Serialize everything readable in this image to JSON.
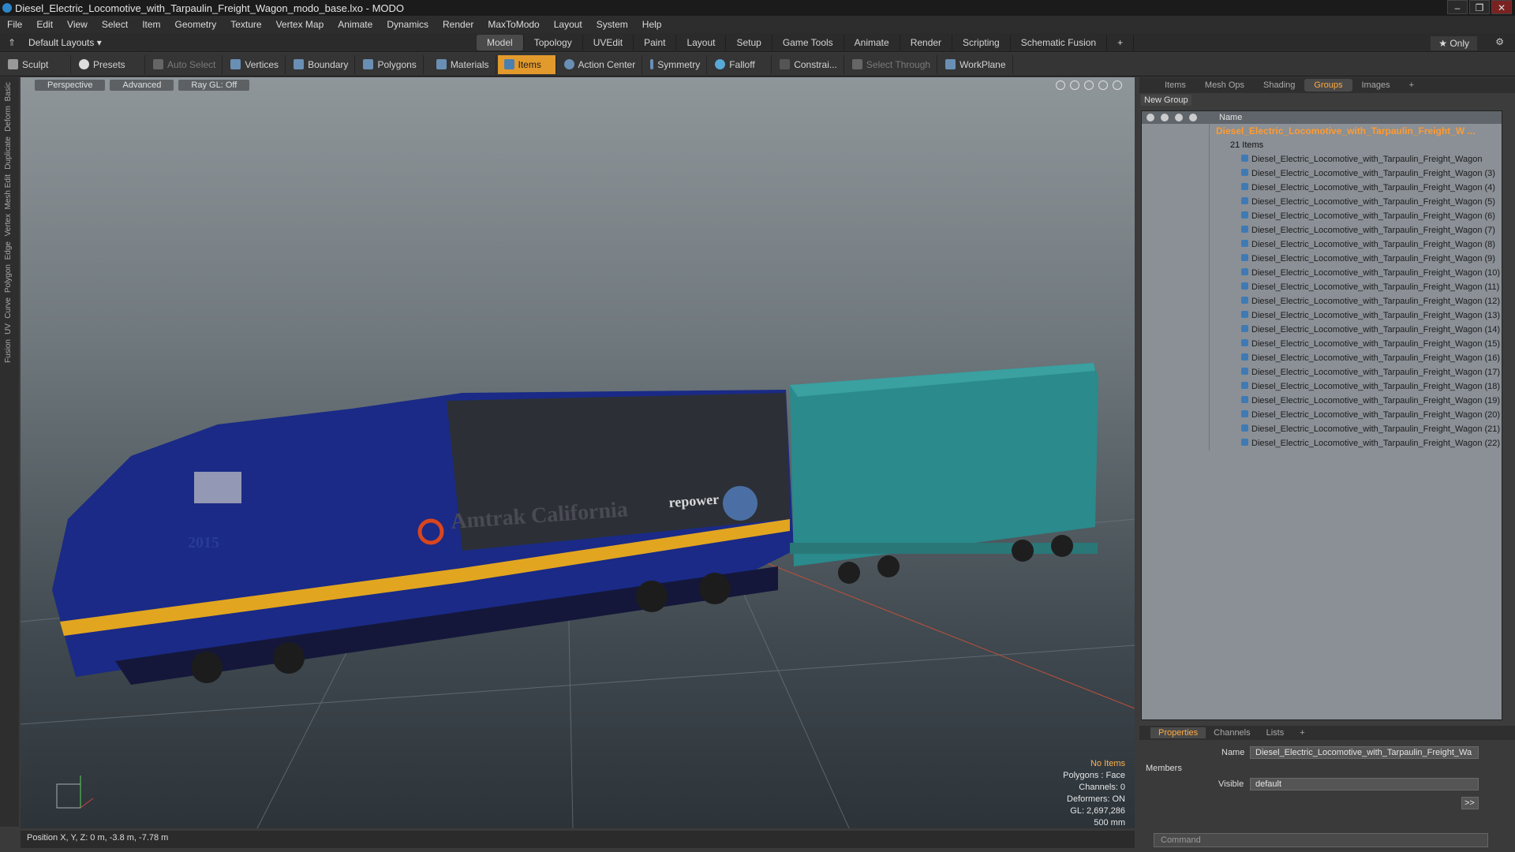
{
  "window": {
    "title": "Diesel_Electric_Locomotive_with_Tarpaulin_Freight_Wagon_modo_base.lxo - MODO",
    "controls": [
      "–",
      "❐",
      "✕"
    ]
  },
  "menu": [
    "File",
    "Edit",
    "View",
    "Select",
    "Item",
    "Geometry",
    "Texture",
    "Vertex Map",
    "Animate",
    "Dynamics",
    "Render",
    "MaxToModo",
    "Layout",
    "System",
    "Help"
  ],
  "mode_bar": {
    "layouts": "Default Layouts ▾",
    "tabs": [
      "Model",
      "Topology",
      "UVEdit",
      "Paint",
      "Layout",
      "Setup",
      "Game Tools",
      "Animate",
      "Render",
      "Scripting",
      "Schematic Fusion",
      "+"
    ],
    "active_tab": "Model",
    "only": "★ Only"
  },
  "toolbar": [
    "Sculpt",
    "Presets",
    "Auto Select",
    "Vertices",
    "Boundary",
    "Polygons",
    "Materials",
    "Items",
    "Action Center",
    "Symmetry",
    "Falloff",
    "Constrai...",
    "Select Through",
    "WorkPlane"
  ],
  "left_tabs": [
    "Basic",
    "Deform",
    "Duplicate",
    "Mesh Edit",
    "Vertex",
    "Edge",
    "Polygon",
    "Curve",
    "UV",
    "Fusion"
  ],
  "viewport": {
    "tabs": [
      "Perspective",
      "Advanced",
      "Ray GL: Off"
    ],
    "locomotive_text": [
      "Amtrak California",
      "repower",
      "2015"
    ],
    "info": {
      "selection": "No Items",
      "lines": [
        "Polygons : Face",
        "Channels: 0",
        "Deformers: ON",
        "GL: 2,697,286",
        "500 mm"
      ]
    }
  },
  "status_bar": "Position X, Y, Z:  0 m, -3.8 m, -7.78 m",
  "right_panel": {
    "tabs": [
      "Items",
      "Mesh Ops",
      "Shading",
      "Groups",
      "Images",
      "+"
    ],
    "active_tab": "Groups",
    "new_group": "New Group",
    "column": "Name",
    "group_name": "Diesel_Electric_Locomotive_with_Tarpaulin_Freight_W ...",
    "item_count": "21 Items",
    "items": [
      "Diesel_Electric_Locomotive_with_Tarpaulin_Freight_Wagon",
      "Diesel_Electric_Locomotive_with_Tarpaulin_Freight_Wagon (3)",
      "Diesel_Electric_Locomotive_with_Tarpaulin_Freight_Wagon (4)",
      "Diesel_Electric_Locomotive_with_Tarpaulin_Freight_Wagon (5)",
      "Diesel_Electric_Locomotive_with_Tarpaulin_Freight_Wagon (6)",
      "Diesel_Electric_Locomotive_with_Tarpaulin_Freight_Wagon (7)",
      "Diesel_Electric_Locomotive_with_Tarpaulin_Freight_Wagon (8)",
      "Diesel_Electric_Locomotive_with_Tarpaulin_Freight_Wagon (9)",
      "Diesel_Electric_Locomotive_with_Tarpaulin_Freight_Wagon (10)",
      "Diesel_Electric_Locomotive_with_Tarpaulin_Freight_Wagon (11)",
      "Diesel_Electric_Locomotive_with_Tarpaulin_Freight_Wagon (12)",
      "Diesel_Electric_Locomotive_with_Tarpaulin_Freight_Wagon (13)",
      "Diesel_Electric_Locomotive_with_Tarpaulin_Freight_Wagon (14)",
      "Diesel_Electric_Locomotive_with_Tarpaulin_Freight_Wagon (15)",
      "Diesel_Electric_Locomotive_with_Tarpaulin_Freight_Wagon (16)",
      "Diesel_Electric_Locomotive_with_Tarpaulin_Freight_Wagon (17)",
      "Diesel_Electric_Locomotive_with_Tarpaulin_Freight_Wagon (18)",
      "Diesel_Electric_Locomotive_with_Tarpaulin_Freight_Wagon (19)",
      "Diesel_Electric_Locomotive_with_Tarpaulin_Freight_Wagon (20)",
      "Diesel_Electric_Locomotive_with_Tarpaulin_Freight_Wagon (21)",
      "Diesel_Electric_Locomotive_with_Tarpaulin_Freight_Wagon (22)"
    ]
  },
  "properties": {
    "tabs": [
      "Properties",
      "Channels",
      "Lists",
      "+"
    ],
    "active_tab": "Properties",
    "name_label": "Name",
    "name_value": "Diesel_Electric_Locomotive_with_Tarpaulin_Freight_Wa",
    "members": "Members",
    "visible_label": "Visible",
    "visible_value": "default",
    "more": ">>",
    "command_placeholder": "Command"
  },
  "colors": {
    "accent": "#e39a2c",
    "group_highlight": "#ff9a30",
    "viewport_top": "#8f969a",
    "viewport_bottom": "#2c3339"
  }
}
